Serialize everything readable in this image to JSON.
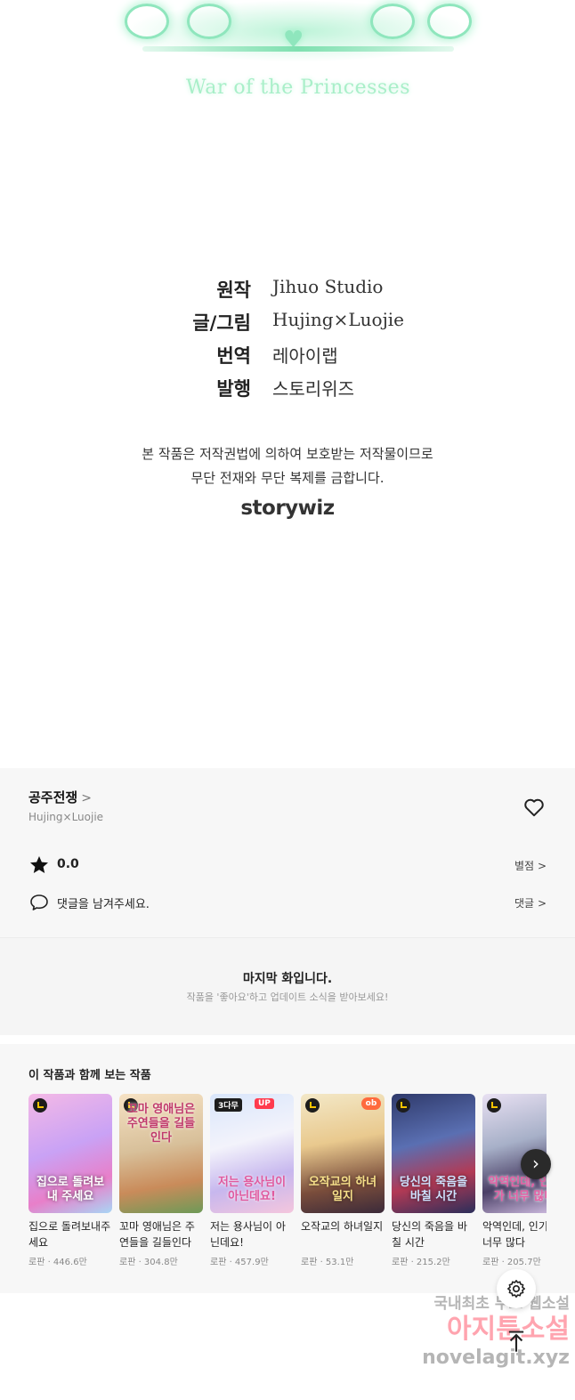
{
  "hero": {
    "logo_subtitle": "War of the Princesses",
    "credits": [
      {
        "key": "원작",
        "value": "Jihuo Studio"
      },
      {
        "key": "글/그림",
        "value": "Hujing×Luojie"
      },
      {
        "key": "번역",
        "value": "레아이랩"
      },
      {
        "key": "발행",
        "value": "스토리위즈"
      }
    ],
    "notice_line1": "본 작품은 저작권법에 의하여 보호받는 저작물이므로",
    "notice_line2": "무단 전재와 무단 복제를 금합니다.",
    "studio_logo": "storywiz"
  },
  "info": {
    "series_title": "공주전쟁",
    "author": "Hujing×Luojie",
    "rating": "0.0",
    "rating_link": "별점",
    "comment_prompt": "댓글을 남겨주세요.",
    "comment_link": "댓글"
  },
  "last_episode": {
    "title": "마지막 화입니다.",
    "subtitle": "작품을 '좋아요'하고 업데이트 소식을 받아보세요!"
  },
  "recommend": {
    "heading": "이 작품과 함께 보는 작품",
    "items": [
      {
        "name": "집으로 돌려보내주세요",
        "meta": "로판 · 446.6만",
        "cover_text": "집으로 돌려보내 주세요",
        "badge": "wait"
      },
      {
        "name": "꼬마 영애님은 주연들을 길들인다",
        "meta": "로판 · 304.8만",
        "cover_text": "꼬마 영애님은 주연들을 길들인다",
        "badge": "wait"
      },
      {
        "name": "저는 용사님이 아닌데요!",
        "meta": "로판 · 457.9만",
        "cover_text": "저는 용사님이 아닌데요!",
        "badge": "3다무",
        "badge2": "UP"
      },
      {
        "name": "오작교의 하녀일지",
        "meta": "로판 · 53.1만",
        "cover_text": "오작교의 하녀일지",
        "badge": "wait",
        "badge3": "ob"
      },
      {
        "name": "당신의 죽음을 바칠 시간",
        "meta": "로판 · 215.2만",
        "cover_text": "당신의 죽음을 바칠 시간",
        "badge": "wait"
      },
      {
        "name": "악역인데, 인기가 너무 많다",
        "meta": "로판 · 205.7만",
        "cover_text": "악역인데, 인기가 너무 많다",
        "badge": "wait"
      }
    ]
  },
  "watermark": {
    "line1": "국내최초 무료 웹소설",
    "line2": "아지툰소설",
    "line3": "novelagit.xyz"
  },
  "colors": {
    "logo_accent": "#8fe6bd",
    "panel_bg": "#f7f7f7",
    "badge_up": "#ff3b4e"
  }
}
